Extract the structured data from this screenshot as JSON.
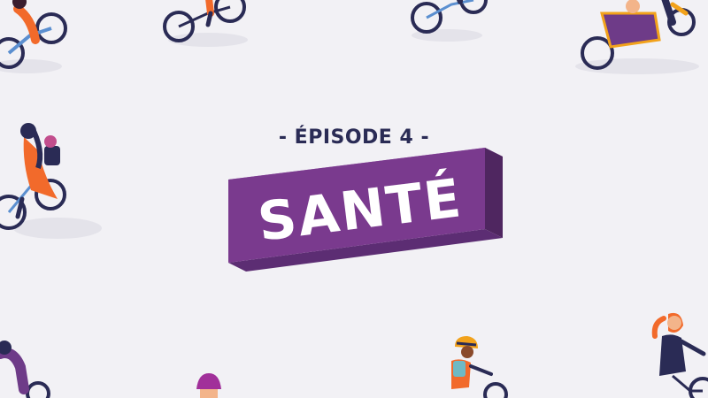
{
  "episode_label": "- ÉPISODE 4 -",
  "title": "SANTÉ",
  "colors": {
    "background": "#f2f1f5",
    "banner_front": "#7a3a8e",
    "banner_top": "#9a5cb0",
    "banner_side": "#4f2660",
    "episode_text": "#2a2b55",
    "bike_frame": "#2a2b55",
    "accent_orange": "#f26a2b"
  },
  "icons": [
    "cyclist-icon",
    "cargo-bike-icon",
    "helmet-icon"
  ]
}
